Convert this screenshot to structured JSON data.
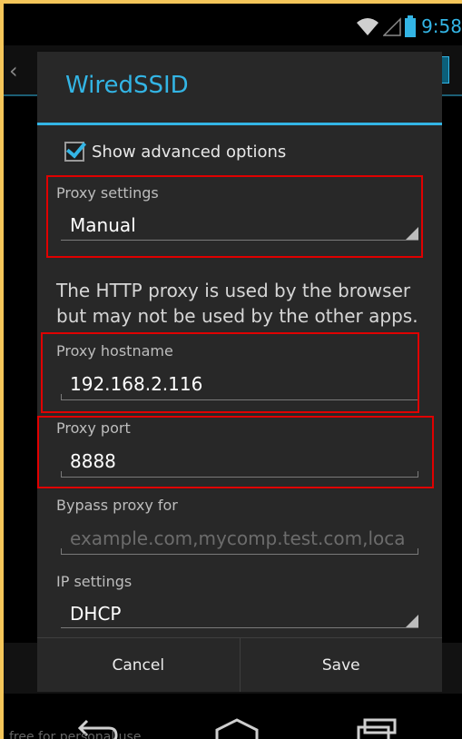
{
  "status_bar": {
    "time": "9:58",
    "icons": [
      "wifi-icon",
      "signal-icon",
      "battery-icon"
    ]
  },
  "dialog": {
    "title": "WiredSSID",
    "advanced_checkbox": {
      "label": "Show advanced options",
      "checked": true
    },
    "proxy_settings": {
      "label": "Proxy settings",
      "value": "Manual"
    },
    "help_text": "The HTTP proxy is used by the browser but may not be used by the other apps.",
    "proxy_hostname": {
      "label": "Proxy hostname",
      "value": "192.168.2.116"
    },
    "proxy_port": {
      "label": "Proxy port",
      "value": "8888"
    },
    "bypass_proxy": {
      "label": "Bypass proxy for",
      "placeholder": "example.com,mycomp.test.com,loca"
    },
    "ip_settings": {
      "label": "IP settings",
      "value": "DHCP"
    },
    "buttons": {
      "cancel": "Cancel",
      "save": "Save"
    }
  },
  "watermark": "free for personal use",
  "colors": {
    "accent": "#33b5e5",
    "highlight": "#e00000",
    "dialog_bg": "#282828"
  }
}
